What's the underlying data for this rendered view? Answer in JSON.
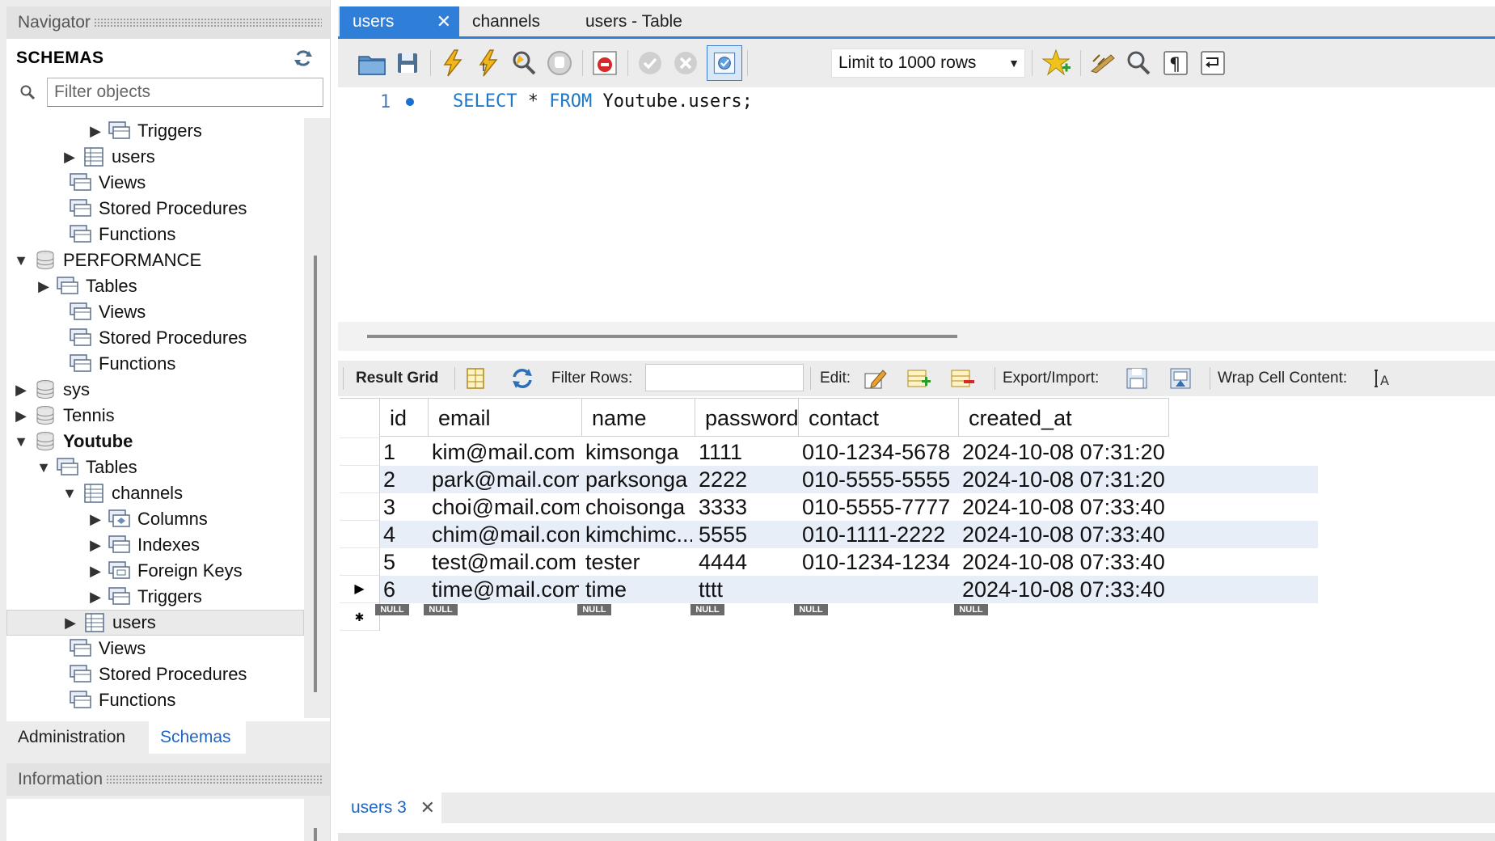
{
  "navigator": {
    "title": "Navigator",
    "schemas_title": "SCHEMAS",
    "filter_placeholder": "Filter objects",
    "tree": [
      {
        "label": "Triggers",
        "toggle": "▶",
        "icon": "folder-icon",
        "bold": false,
        "selected": false,
        "indent": 1
      },
      {
        "label": "users",
        "toggle": "▶",
        "icon": "table-icon",
        "bold": false,
        "selected": false,
        "indent": 2
      },
      {
        "label": "Views",
        "toggle": "",
        "icon": "folder-icon",
        "bold": false,
        "selected": false,
        "indent": 3
      },
      {
        "label": "Stored Procedures",
        "toggle": "",
        "icon": "folder-icon",
        "bold": false,
        "selected": false,
        "indent": 3
      },
      {
        "label": "Functions",
        "toggle": "",
        "icon": "folder-icon",
        "bold": false,
        "selected": false,
        "indent": 3
      },
      {
        "label": "PERFORMANCE",
        "toggle": "▼",
        "icon": "database-icon",
        "bold": false,
        "selected": false,
        "indent": 4
      },
      {
        "label": "Tables",
        "toggle": "▶",
        "icon": "folder-icon",
        "bold": false,
        "selected": false,
        "indent": 5
      },
      {
        "label": "Views",
        "toggle": "",
        "icon": "folder-icon",
        "bold": false,
        "selected": false,
        "indent": 3
      },
      {
        "label": "Stored Procedures",
        "toggle": "",
        "icon": "folder-icon",
        "bold": false,
        "selected": false,
        "indent": 3
      },
      {
        "label": "Functions",
        "toggle": "",
        "icon": "folder-icon",
        "bold": false,
        "selected": false,
        "indent": 3
      },
      {
        "label": "sys",
        "toggle": "▶",
        "icon": "database-icon",
        "bold": false,
        "selected": false,
        "indent": 4
      },
      {
        "label": "Tennis",
        "toggle": "▶",
        "icon": "database-icon",
        "bold": false,
        "selected": false,
        "indent": 4
      },
      {
        "label": "Youtube",
        "toggle": "▼",
        "icon": "database-icon",
        "bold": true,
        "selected": false,
        "indent": 4
      },
      {
        "label": "Tables",
        "toggle": "▼",
        "icon": "folder-icon",
        "bold": false,
        "selected": false,
        "indent": 5
      },
      {
        "label": "channels",
        "toggle": "▼",
        "icon": "table-icon",
        "bold": false,
        "selected": false,
        "indent": 2
      },
      {
        "label": "Columns",
        "toggle": "▶",
        "icon": "columns-icon",
        "bold": false,
        "selected": false,
        "indent": 1
      },
      {
        "label": "Indexes",
        "toggle": "▶",
        "icon": "folder-icon",
        "bold": false,
        "selected": false,
        "indent": 1
      },
      {
        "label": "Foreign Keys",
        "toggle": "▶",
        "icon": "foreign-keys-icon",
        "bold": false,
        "selected": false,
        "indent": 1
      },
      {
        "label": "Triggers",
        "toggle": "▶",
        "icon": "folder-icon",
        "bold": false,
        "selected": false,
        "indent": 1
      },
      {
        "label": "users",
        "toggle": "▶",
        "icon": "table-icon",
        "bold": false,
        "selected": true,
        "indent": 2
      },
      {
        "label": "Views",
        "toggle": "",
        "icon": "folder-icon",
        "bold": false,
        "selected": false,
        "indent": 3
      },
      {
        "label": "Stored Procedures",
        "toggle": "",
        "icon": "folder-icon",
        "bold": false,
        "selected": false,
        "indent": 3
      },
      {
        "label": "Functions",
        "toggle": "",
        "icon": "folder-icon",
        "bold": false,
        "selected": false,
        "indent": 3
      }
    ],
    "tabs": {
      "administration": "Administration",
      "schemas": "Schemas"
    },
    "information_title": "Information"
  },
  "query_tabs": {
    "users": "users",
    "channels": "channels",
    "users_table": "users - Table",
    "close_glyph": "✕"
  },
  "toolbar": {
    "limit_label": "Limit to 1000 rows",
    "dropdown_glyph": "▼"
  },
  "editor": {
    "line_number": "1",
    "sql": {
      "select": "SELECT",
      "star": " * ",
      "from": "FROM",
      "target": " Youtube.users;"
    }
  },
  "result_toolbar": {
    "result_grid": "Result Grid",
    "filter_rows": "Filter Rows:",
    "edit": "Edit:",
    "export_import": "Export/Import:",
    "wrap_cell": "Wrap Cell Content:"
  },
  "grid": {
    "columns": [
      "id",
      "email",
      "name",
      "password",
      "contact",
      "created_at"
    ],
    "rows": [
      [
        "1",
        "kim@mail.com",
        "kimsonga",
        "1111",
        "010-1234-5678",
        "2024-10-08 07:31:20"
      ],
      [
        "2",
        "park@mail.com",
        "parksonga",
        "2222",
        "010-5555-5555",
        "2024-10-08 07:31:20"
      ],
      [
        "3",
        "choi@mail.com",
        "choisonga",
        "3333",
        "010-5555-7777",
        "2024-10-08 07:33:40"
      ],
      [
        "4",
        "chim@mail.com",
        "kimchimc...",
        "5555",
        "010-1111-2222",
        "2024-10-08 07:33:40"
      ],
      [
        "5",
        "test@mail.com",
        "tester",
        "4444",
        "010-1234-1234",
        "2024-10-08 07:33:40"
      ],
      [
        "6",
        "time@mail.com",
        "time",
        "tttt",
        "",
        "2024-10-08 07:33:40"
      ]
    ],
    "null_label": "NULL",
    "current_row_marker": "▶",
    "new_row_marker": "✱"
  },
  "result_tabs": {
    "users3": "users 3",
    "close_glyph": "✕"
  },
  "colors": {
    "accent": "#2f7fd8",
    "keyword": "#1e78c8",
    "row_alt": "#e8eef8",
    "null_badge": "#6b6b6b"
  }
}
